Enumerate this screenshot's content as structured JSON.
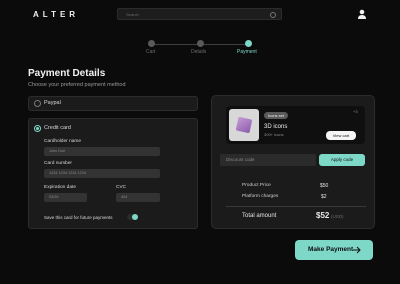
{
  "header": {
    "logo": "ALTER",
    "search_placeholder": "Search"
  },
  "steps": [
    {
      "label": "Cart"
    },
    {
      "label": "Details"
    },
    {
      "label": "Payment"
    }
  ],
  "accent": "#7ed8c8",
  "page": {
    "title": "Payment Details",
    "subtitle": "Choose your preferred payment method"
  },
  "methods": {
    "paypal": "Paypal",
    "credit": "Credit card"
  },
  "form": {
    "holder_label": "Cardholder name",
    "holder_value": "John Doe",
    "number_label": "Card number",
    "number_value": "1234  1234  1234  1234",
    "exp_label": "Expiration date",
    "exp_value": "03/26",
    "cvc_label": "CVC",
    "cvc_value": "404",
    "save_label": "Save this card for future payments"
  },
  "product": {
    "badge": "Icons set",
    "name": "3D icons",
    "count": "300+ icons",
    "more": "+3",
    "view_cart": "View cart"
  },
  "discount": {
    "placeholder": "Discount code",
    "apply": "Apply code"
  },
  "summary": {
    "price_label": "Product Price",
    "price": "$50",
    "charges_label": "Platform charges",
    "charges": "$2",
    "total_label": "Total amount",
    "total": "$52",
    "currency": "(USD)"
  },
  "cta": "Make Payment"
}
